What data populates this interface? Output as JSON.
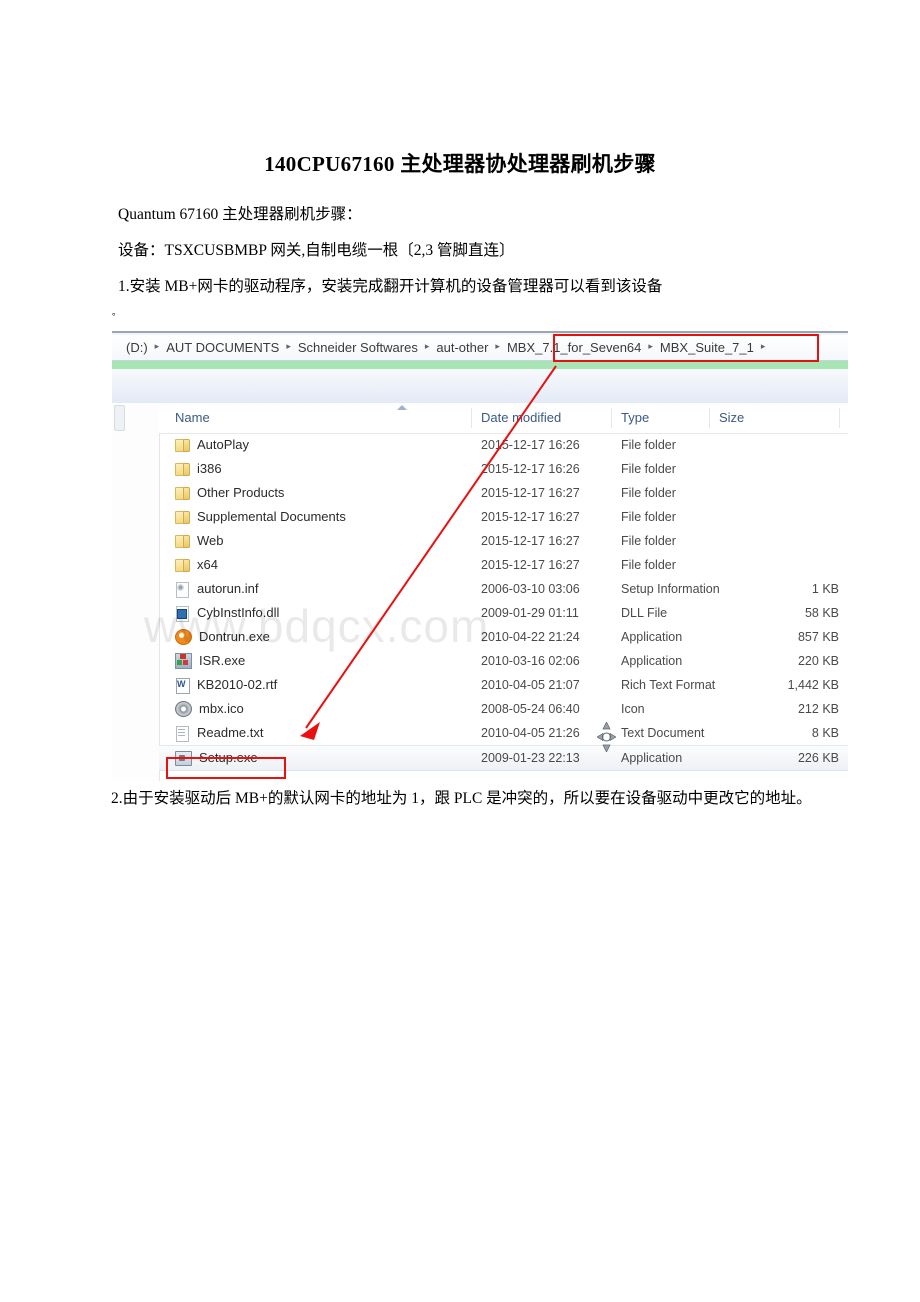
{
  "document": {
    "title": "140CPU67160 主处理器协处理器刷机步骤",
    "paragraphs": {
      "p1": "Quantum 67160 主处理器刷机步骤：",
      "p2": "设备：TSXCUSBMBP 网关,自制电缆一根〔2,3 管脚直连〕",
      "p3": "1.安装 MB+网卡的驱动程序，安装完成翻开计算机的设备管理器可以看到该设备",
      "p4": "。",
      "tail": "2.由于安装驱动后 MB+的默认网卡的地址为 1，跟 PLC 是冲突的，所以要在设备驱动中更改它的地址。"
    }
  },
  "screenshot": {
    "watermark": "www.bdqcx.com",
    "address_bar": {
      "crumbs": [
        "(D:)",
        "AUT DOCUMENTS",
        "Schneider Softwares",
        "aut-other",
        "MBX_7.1_for_Seven64",
        "MBX_Suite_7_1"
      ],
      "separator": "▸"
    },
    "columns": [
      {
        "label": "Name",
        "key": "name"
      },
      {
        "label": "Date modified",
        "key": "date"
      },
      {
        "label": "Type",
        "key": "type"
      },
      {
        "label": "Size",
        "key": "size"
      }
    ],
    "rows": [
      {
        "name": "AutoPlay",
        "date": "2015-12-17 16:26",
        "type": "File folder",
        "size": "",
        "icon": "folder-icon",
        "selected": false
      },
      {
        "name": "i386",
        "date": "2015-12-17 16:26",
        "type": "File folder",
        "size": "",
        "icon": "folder-icon",
        "selected": false
      },
      {
        "name": "Other Products",
        "date": "2015-12-17 16:27",
        "type": "File folder",
        "size": "",
        "icon": "folder-icon",
        "selected": false
      },
      {
        "name": "Supplemental Documents",
        "date": "2015-12-17 16:27",
        "type": "File folder",
        "size": "",
        "icon": "folder-icon",
        "selected": false
      },
      {
        "name": "Web",
        "date": "2015-12-17 16:27",
        "type": "File folder",
        "size": "",
        "icon": "folder-icon",
        "selected": false
      },
      {
        "name": "x64",
        "date": "2015-12-17 16:27",
        "type": "File folder",
        "size": "",
        "icon": "folder-icon",
        "selected": false
      },
      {
        "name": "autorun.inf",
        "date": "2006-03-10 03:06",
        "type": "Setup Information",
        "size": "1 KB",
        "icon": "inf-file-icon",
        "selected": false
      },
      {
        "name": "CybInstInfo.dll",
        "date": "2009-01-29 01:11",
        "type": "DLL File",
        "size": "58 KB",
        "icon": "dll-file-icon",
        "selected": false
      },
      {
        "name": "Dontrun.exe",
        "date": "2010-04-22 21:24",
        "type": "Application",
        "size": "857 KB",
        "icon": "application-icon",
        "selected": false
      },
      {
        "name": "ISR.exe",
        "date": "2010-03-16 02:06",
        "type": "Application",
        "size": "220 KB",
        "icon": "installer-icon",
        "selected": false
      },
      {
        "name": "KB2010-02.rtf",
        "date": "2010-04-05 21:07",
        "type": "Rich Text Format",
        "size": "1,442 KB",
        "icon": "wordpad-icon",
        "selected": false
      },
      {
        "name": "mbx.ico",
        "date": "2008-05-24 06:40",
        "type": "Icon",
        "size": "212 KB",
        "icon": "icon-file-icon",
        "selected": false
      },
      {
        "name": "Readme.txt",
        "date": "2010-04-05 21:26",
        "type": "Text Document",
        "size": "8 KB",
        "icon": "text-document-icon",
        "selected": false
      },
      {
        "name": "Setup.exe",
        "date": "2009-01-23 22:13",
        "type": "Application",
        "size": "226 KB",
        "icon": "setup-icon",
        "selected": true
      }
    ]
  },
  "annotations": {
    "highlight_color": "#e8110f",
    "boxes": [
      {
        "name": "crumb-highlight",
        "target": "MBX_7.1_for_Seven64 ▸ MBX_Suite_7_1 ▸"
      },
      {
        "name": "setup-highlight",
        "target": "Setup.exe"
      }
    ],
    "arrow": {
      "from": "MBX_7.1_for_Seven64 breadcrumb",
      "to": "Readme.txt / Setup.exe area"
    }
  }
}
